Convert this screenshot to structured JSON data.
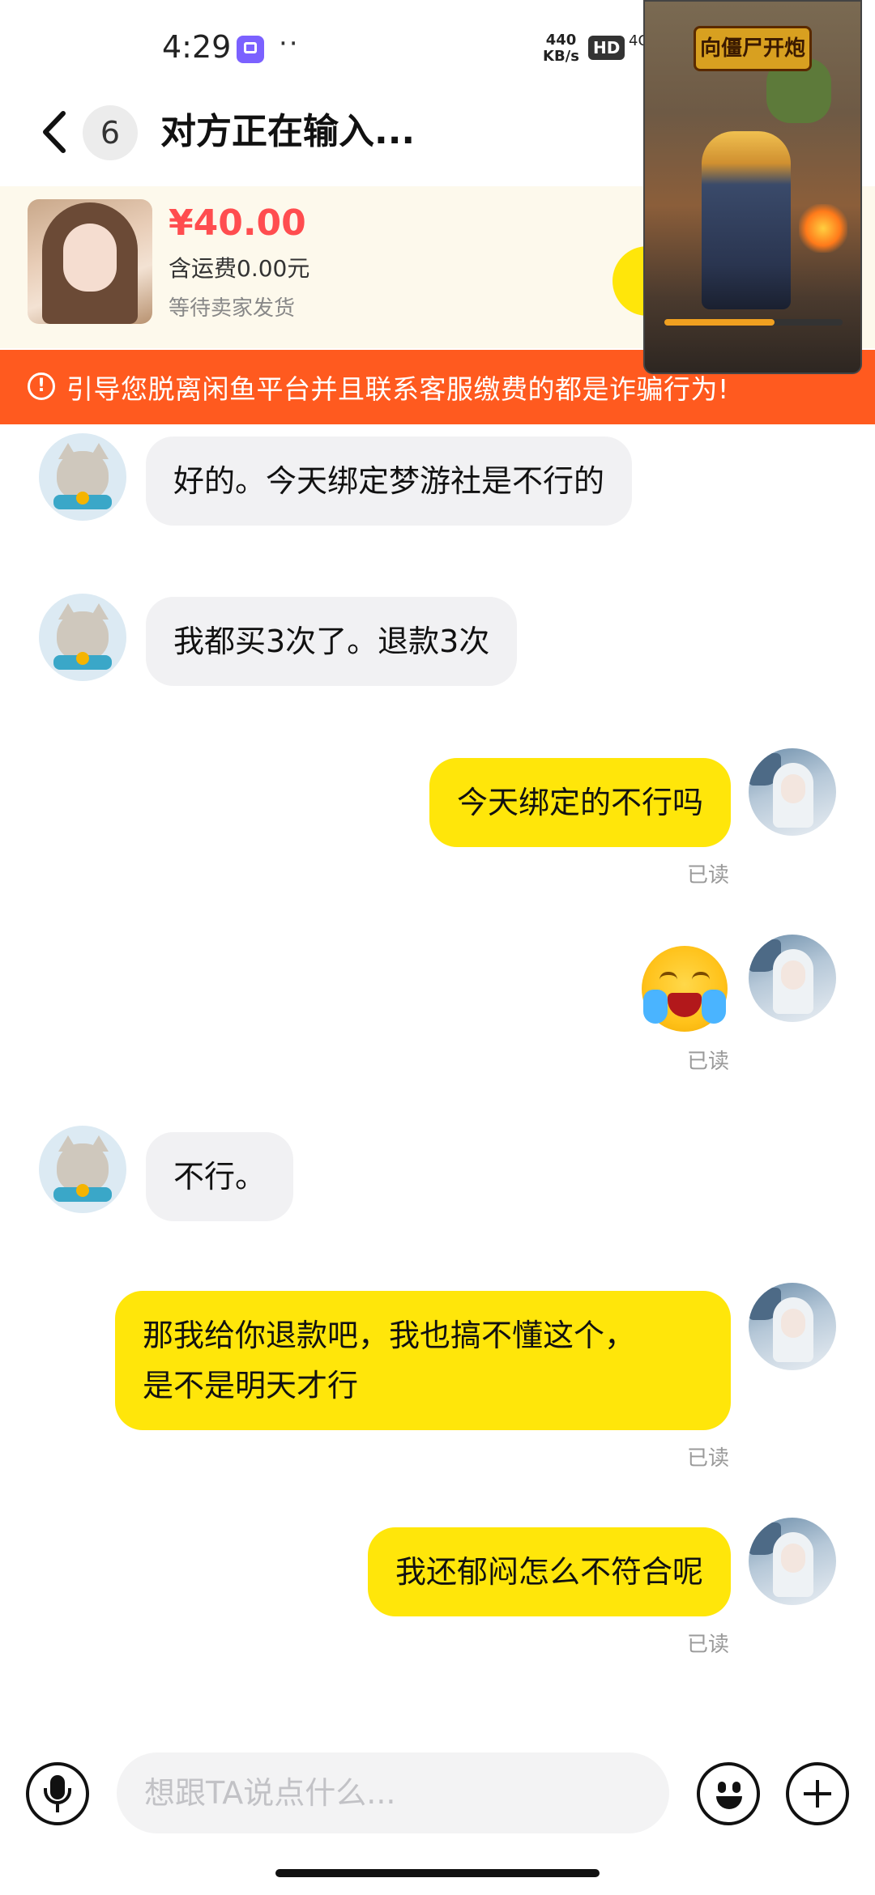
{
  "status_bar": {
    "time": "4:29",
    "dots": "··",
    "net_speed_value": "440",
    "net_speed_unit": "KB/s",
    "hd_label": "HD",
    "network_type": "4G"
  },
  "header": {
    "badge_count": "6",
    "title": "对方正在输入..."
  },
  "product": {
    "price": "¥40.00",
    "shipping": "含运费0.00元",
    "status": "等待卖家发货"
  },
  "warning": {
    "text": "引导您脱离闲鱼平台并且联系客服缴费的都是诈骗行为!"
  },
  "game_overlay": {
    "logo_text": "向僵尸开炮",
    "progress_fraction": 0.62
  },
  "messages": [
    {
      "sender": "seller",
      "text": "好的。今天绑定梦游社是不行的"
    },
    {
      "sender": "seller",
      "text": "我都买3次了。退款3次"
    },
    {
      "sender": "buyer",
      "text": "今天绑定的不行吗",
      "receipt": "已读"
    },
    {
      "sender": "buyer",
      "type": "sticker",
      "icon": "crying-laugh-emoji",
      "receipt": "已读"
    },
    {
      "sender": "seller",
      "text": "不行。"
    },
    {
      "sender": "buyer",
      "text": "那我给你退款吧，我也搞不懂这个，是不是明天才行",
      "receipt": "已读"
    },
    {
      "sender": "buyer",
      "text": "我还郁闷怎么不符合呢",
      "receipt": "已读"
    }
  ],
  "input": {
    "placeholder": "想跟TA说点什么..."
  },
  "icons": {
    "back": "back-icon",
    "mic": "microphone-icon",
    "emoji": "emoji-icon",
    "plus": "plus-icon",
    "warning": "warning-icon"
  },
  "colors": {
    "accent_yellow": "#ffe60a",
    "warning_orange": "#ff5a1f",
    "price_red": "#ff4d4f"
  }
}
